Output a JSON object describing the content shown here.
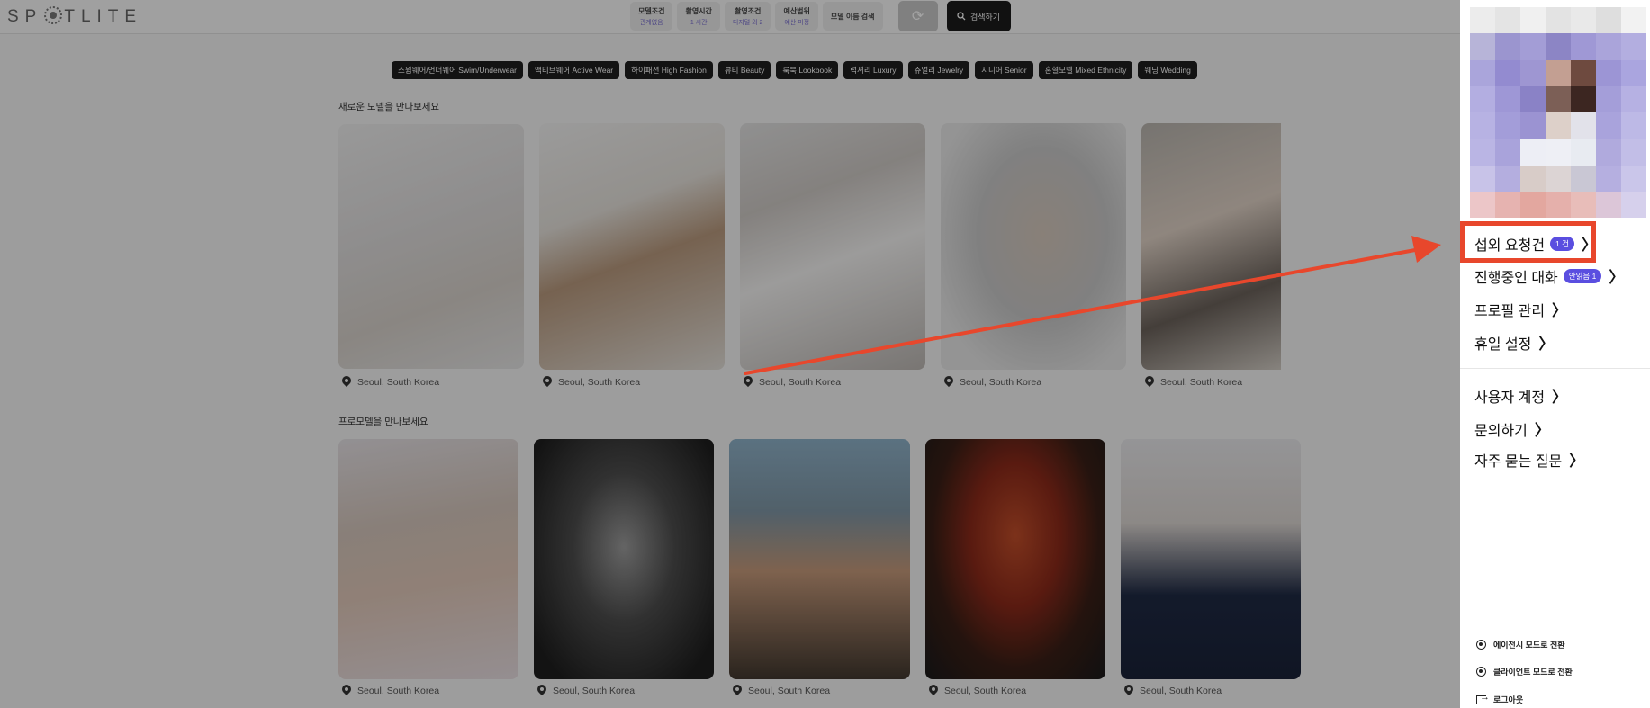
{
  "header": {
    "logo_text_left": "SP",
    "logo_text_right": "TLITE",
    "filters": [
      {
        "title": "모델조건",
        "value": "관계없음"
      },
      {
        "title": "촬영시간",
        "value": "1 시간"
      },
      {
        "title": "촬영조건",
        "value": "디지털 외 2"
      },
      {
        "title": "예산범위",
        "value": "예산 미정"
      }
    ],
    "name_search_label": "모델 이름 검색",
    "refresh_icon": "⟳",
    "search_label": "검색하기"
  },
  "categories": [
    "스윔웨어/언더웨어 Swim/Underwear",
    "액티브웨어 Active Wear",
    "하이패션 High Fashion",
    "뷰티 Beauty",
    "룩북 Lookbook",
    "럭셔리 Luxury",
    "쥬얼리 Jewelry",
    "시니어 Senior",
    "혼혈모델 Mixed Ethnicity",
    "웨딩 Wedding"
  ],
  "new_models": {
    "title": "새로운 모델을 만나보세요",
    "locations": [
      "Seoul, South Korea",
      "Seoul, South Korea",
      "Seoul, South Korea",
      "Seoul, South Korea",
      "Seoul, South Korea"
    ]
  },
  "pro_models": {
    "title": "프로모델을 만나보세요",
    "locations": [
      "Seoul, South Korea",
      "Seoul, South Korea",
      "Seoul, South Korea",
      "Seoul, South Korea",
      "Seoul, South Korea"
    ]
  },
  "drawer": {
    "menu": [
      {
        "label": "섭외 요청건",
        "badge": "1 건"
      },
      {
        "label": "진행중인 대화",
        "badge": "안읽음 1"
      },
      {
        "label": "프로필 관리",
        "badge": ""
      },
      {
        "label": "휴일 설정",
        "badge": ""
      },
      {
        "label": "사용자 계정",
        "badge": ""
      },
      {
        "label": "문의하기",
        "badge": ""
      },
      {
        "label": "자주 묻는 질문",
        "badge": ""
      }
    ],
    "chevron": "〉",
    "bottom": [
      {
        "label": "에이전시 모드로 전환"
      },
      {
        "label": "클라이언트 모드로 전환"
      },
      {
        "label": "로그아웃"
      }
    ]
  },
  "colors": {
    "annotation_red": "#e8472c",
    "badge_purple": "#5a4ee0"
  }
}
